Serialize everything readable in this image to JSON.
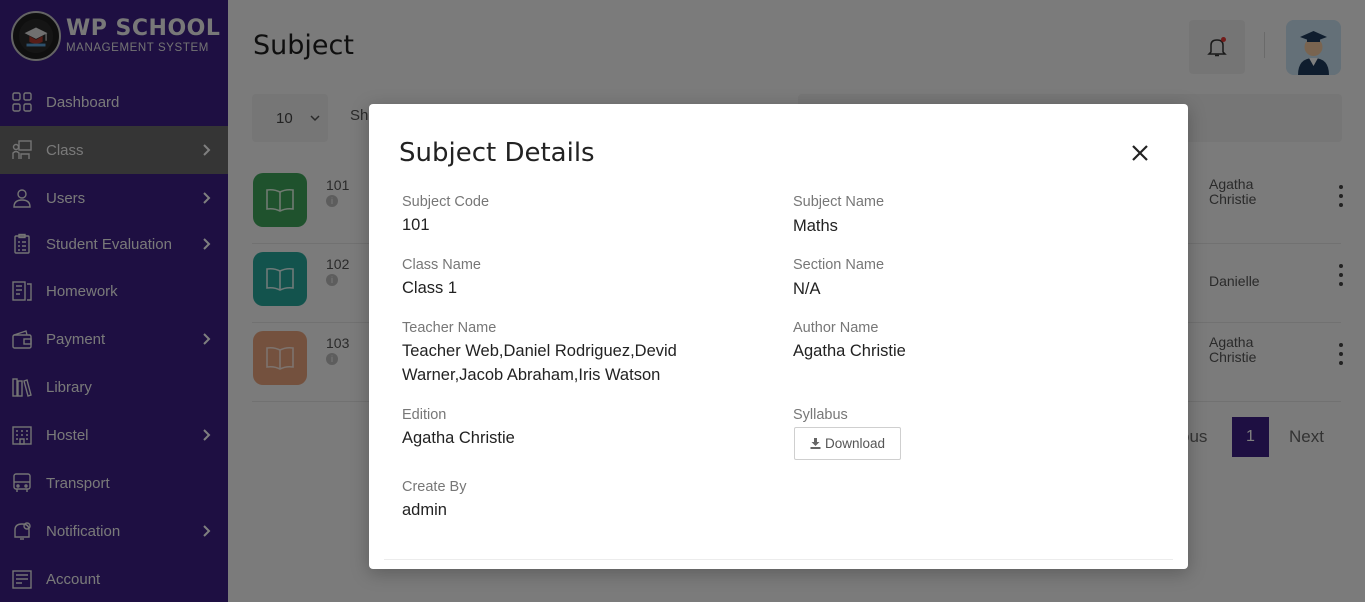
{
  "brand": {
    "title": "WP SCHOOL",
    "subtitle": "MANAGEMENT SYSTEM"
  },
  "sidebar": {
    "items": [
      {
        "label": "Dashboard",
        "icon": "grid-icon",
        "has_arrow": false,
        "active": false
      },
      {
        "label": "Class",
        "icon": "classroom-icon",
        "has_arrow": true,
        "active": true
      },
      {
        "label": "Users",
        "icon": "user-icon",
        "has_arrow": true,
        "active": false
      },
      {
        "label": "Student Evaluation",
        "icon": "clipboard-icon",
        "has_arrow": true,
        "active": false
      },
      {
        "label": "Homework",
        "icon": "homework-icon",
        "has_arrow": false,
        "active": false
      },
      {
        "label": "Payment",
        "icon": "wallet-icon",
        "has_arrow": true,
        "active": false
      },
      {
        "label": "Library",
        "icon": "books-icon",
        "has_arrow": false,
        "active": false
      },
      {
        "label": "Hostel",
        "icon": "building-icon",
        "has_arrow": true,
        "active": false
      },
      {
        "label": "Transport",
        "icon": "bus-icon",
        "has_arrow": false,
        "active": false
      },
      {
        "label": "Notification",
        "icon": "notification-icon",
        "has_arrow": true,
        "active": false
      },
      {
        "label": "Account",
        "icon": "account-icon",
        "has_arrow": false,
        "active": false
      }
    ]
  },
  "header": {
    "title": "Subject"
  },
  "controls": {
    "page_size": "10",
    "show_text": "Sh"
  },
  "table": {
    "rows": [
      {
        "code": "101",
        "author_line1": "Agatha",
        "author_line2": "Christie",
        "tile_color": "#3fa45a"
      },
      {
        "code": "102",
        "author_line1": "Danielle",
        "author_line2": "",
        "tile_color": "#26a69a"
      },
      {
        "code": "103",
        "author_line1": "Agatha",
        "author_line2": "Christie",
        "tile_color": "#e8a27c"
      }
    ]
  },
  "pagination": {
    "previous": "ous",
    "current": "1",
    "next": "Next"
  },
  "modal": {
    "title": "Subject Details",
    "fields": {
      "subject_code_label": "Subject Code",
      "subject_code": "101",
      "subject_name_label": "Subject Name",
      "subject_name": "Maths",
      "class_name_label": "Class Name",
      "class_name": "Class 1",
      "section_name_label": "Section Name",
      "section_name": "N/A",
      "teacher_name_label": "Teacher Name",
      "teacher_name_line1": "Teacher Web,Daniel Rodriguez,Devid",
      "teacher_name_line2": "Warner,Jacob Abraham,Iris Watson",
      "author_name_label": "Author Name",
      "author_name": "Agatha Christie",
      "edition_label": "Edition",
      "edition": "Agatha Christie",
      "syllabus_label": "Syllabus",
      "download_label": "Download",
      "create_by_label": "Create By",
      "create_by": "admin"
    }
  },
  "colors": {
    "sidebar": "#3c1f84",
    "active_item": "#6a6a6a",
    "accent": "#3c1f84"
  }
}
